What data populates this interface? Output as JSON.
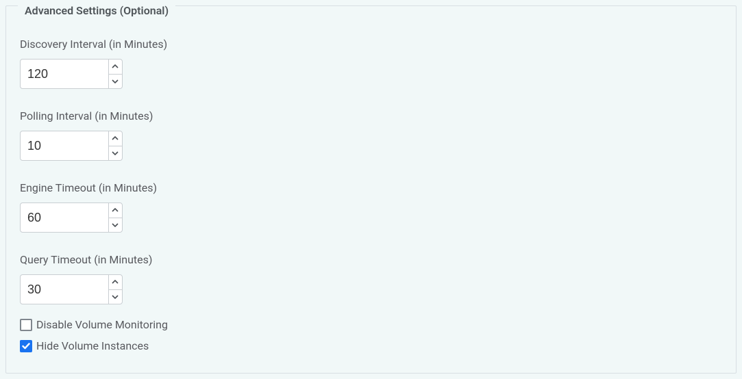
{
  "section": {
    "title": "Advanced Settings (Optional)"
  },
  "fields": {
    "discovery": {
      "label": "Discovery Interval (in Minutes)",
      "value": "120"
    },
    "polling": {
      "label": "Polling Interval (in Minutes)",
      "value": "10"
    },
    "engine": {
      "label": "Engine Timeout (in Minutes)",
      "value": "60"
    },
    "query": {
      "label": "Query Timeout (in Minutes)",
      "value": "30"
    }
  },
  "checkboxes": {
    "disable_volume_monitoring": {
      "label": "Disable Volume Monitoring",
      "checked": false
    },
    "hide_volume_instances": {
      "label": "Hide Volume Instances",
      "checked": true
    }
  }
}
